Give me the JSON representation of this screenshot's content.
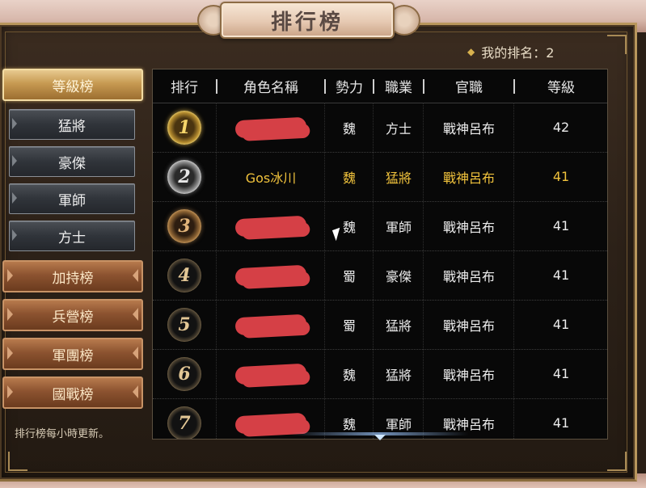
{
  "window": {
    "title": "排行榜"
  },
  "my_rank": {
    "label": "我的排名：2"
  },
  "menu": {
    "level_rank": "等級榜",
    "sub_items": [
      "猛將",
      "豪傑",
      "軍師",
      "方士"
    ],
    "buff_rank": "加持榜",
    "barracks_rank": "兵營榜",
    "legion_rank": "軍團榜",
    "nation_war_rank": "國戰榜"
  },
  "footer": {
    "note": "排行榜每小時更新。"
  },
  "table": {
    "headers": [
      "排行",
      "角色名稱",
      "勢力",
      "職業",
      "官職",
      "等級"
    ],
    "rows": [
      {
        "rank": "1",
        "name": "",
        "faction": "魏",
        "class": "方士",
        "title": "戰神呂布",
        "level": "42",
        "highlight": false
      },
      {
        "rank": "2",
        "name": "Gos冰川",
        "faction": "魏",
        "class": "猛將",
        "title": "戰神呂布",
        "level": "41",
        "highlight": true
      },
      {
        "rank": "3",
        "name": "",
        "faction": "魏",
        "class": "軍師",
        "title": "戰神呂布",
        "level": "41",
        "highlight": false
      },
      {
        "rank": "4",
        "name": "",
        "faction": "蜀",
        "class": "豪傑",
        "title": "戰神呂布",
        "level": "41",
        "highlight": false
      },
      {
        "rank": "5",
        "name": "",
        "faction": "蜀",
        "class": "猛將",
        "title": "戰神呂布",
        "level": "41",
        "highlight": false
      },
      {
        "rank": "6",
        "name": "",
        "faction": "魏",
        "class": "猛將",
        "title": "戰神呂布",
        "level": "41",
        "highlight": false
      },
      {
        "rank": "7",
        "name": "",
        "faction": "魏",
        "class": "軍師",
        "title": "戰神呂布",
        "level": "41",
        "highlight": false
      }
    ]
  },
  "colors": {
    "highlight_text": "#f0c23c",
    "redaction": "#e0434a",
    "accent_gold": "#d9b24e"
  }
}
